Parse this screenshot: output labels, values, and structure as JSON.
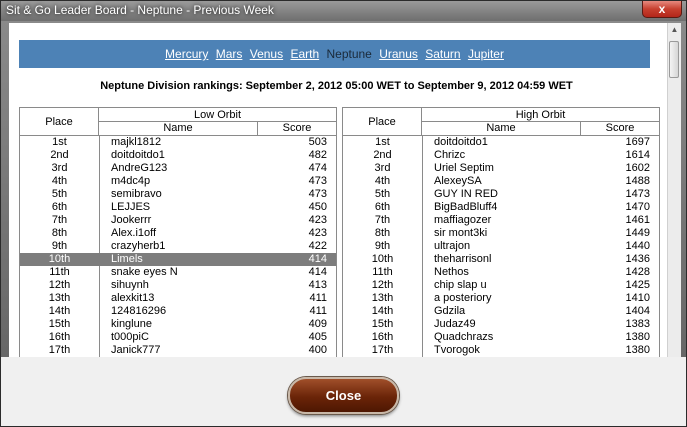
{
  "window": {
    "title": "Sit & Go Leader Board - Neptune - Previous Week",
    "close_glyph": "x"
  },
  "planet_nav": {
    "items": [
      {
        "label": "Mercury",
        "current": false
      },
      {
        "label": "Mars",
        "current": false
      },
      {
        "label": "Venus",
        "current": false
      },
      {
        "label": "Earth",
        "current": false
      },
      {
        "label": "Neptune",
        "current": true
      },
      {
        "label": "Uranus",
        "current": false
      },
      {
        "label": "Saturn",
        "current": false
      },
      {
        "label": "Jupiter",
        "current": false
      }
    ]
  },
  "division_heading": "Neptune Division rankings: September 2, 2012 05:00 WET to September 9, 2012 04:59 WET",
  "boards": [
    {
      "key": "low-orbit",
      "group_label": "Low Orbit",
      "place_header": "Place",
      "name_header": "Name",
      "score_header": "Score",
      "selected_index": 9,
      "rows": [
        {
          "place": "1st",
          "name": "majkl1812",
          "score": "503"
        },
        {
          "place": "2nd",
          "name": "doitdoitdo1",
          "score": "482"
        },
        {
          "place": "3rd",
          "name": "AndreG123",
          "score": "474"
        },
        {
          "place": "4th",
          "name": "m4dc4p",
          "score": "473"
        },
        {
          "place": "5th",
          "name": "semibravo",
          "score": "473"
        },
        {
          "place": "6th",
          "name": "LEJJES",
          "score": "450"
        },
        {
          "place": "7th",
          "name": "Jookerrr",
          "score": "423"
        },
        {
          "place": "8th",
          "name": "Alex.i1off",
          "score": "423"
        },
        {
          "place": "9th",
          "name": "crazyherb1",
          "score": "422"
        },
        {
          "place": "10th",
          "name": "Limels",
          "score": "414"
        },
        {
          "place": "11th",
          "name": "snake eyes N",
          "score": "414"
        },
        {
          "place": "12th",
          "name": "sihuynh",
          "score": "413"
        },
        {
          "place": "13th",
          "name": "alexkit13",
          "score": "411"
        },
        {
          "place": "14th",
          "name": "124816296",
          "score": "411"
        },
        {
          "place": "15th",
          "name": "kinglune",
          "score": "409"
        },
        {
          "place": "16th",
          "name": "t000piC",
          "score": "405"
        },
        {
          "place": "17th",
          "name": "Janick777",
          "score": "400"
        }
      ]
    },
    {
      "key": "high-orbit",
      "group_label": "High Orbit",
      "place_header": "Place",
      "name_header": "Name",
      "score_header": "Score",
      "selected_index": -1,
      "rows": [
        {
          "place": "1st",
          "name": "doitdoitdo1",
          "score": "1697"
        },
        {
          "place": "2nd",
          "name": "Chrizc",
          "score": "1614"
        },
        {
          "place": "3rd",
          "name": "Uriel Septim",
          "score": "1602"
        },
        {
          "place": "4th",
          "name": "AlexeySA",
          "score": "1488"
        },
        {
          "place": "5th",
          "name": "GUY IN RED",
          "score": "1473"
        },
        {
          "place": "6th",
          "name": "BigBadBluff4",
          "score": "1470"
        },
        {
          "place": "7th",
          "name": "maffiagozer",
          "score": "1461"
        },
        {
          "place": "8th",
          "name": "sir mont3ki",
          "score": "1449"
        },
        {
          "place": "9th",
          "name": "ultrajon",
          "score": "1440"
        },
        {
          "place": "10th",
          "name": "theharrisonl",
          "score": "1436"
        },
        {
          "place": "11th",
          "name": "Nethos",
          "score": "1428"
        },
        {
          "place": "12th",
          "name": "chip slap u",
          "score": "1425"
        },
        {
          "place": "13th",
          "name": "a posteriory",
          "score": "1410"
        },
        {
          "place": "14th",
          "name": "Gdzila",
          "score": "1404"
        },
        {
          "place": "15th",
          "name": "Judaz49",
          "score": "1383"
        },
        {
          "place": "16th",
          "name": "Quadchrazs",
          "score": "1380"
        },
        {
          "place": "17th",
          "name": "Tvorogok",
          "score": "1380"
        }
      ]
    }
  ],
  "footer": {
    "close_label": "Close"
  },
  "colors": {
    "nav_bar": "#4d82b6",
    "selected_row": "#7d7d7d",
    "close_button": "#6a2408",
    "window_close": "#c7402f"
  },
  "icons": {
    "window_close": "close-icon",
    "scroll_up": "scroll-up-arrow-icon"
  }
}
